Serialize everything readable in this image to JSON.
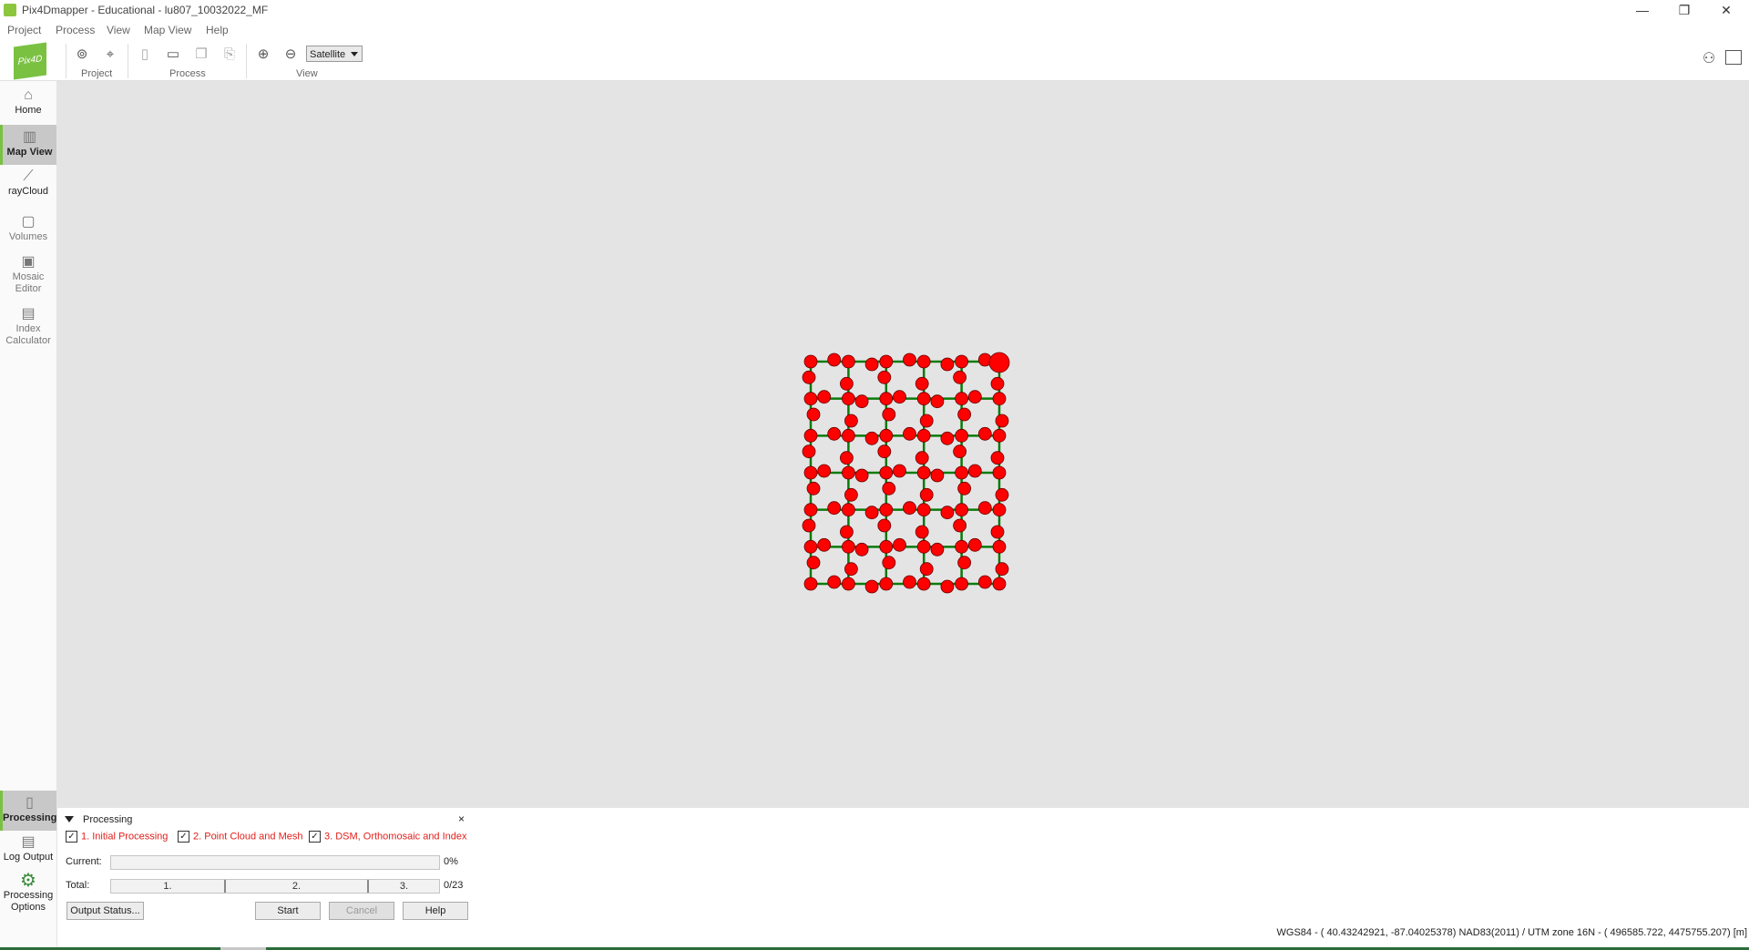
{
  "window": {
    "title": "Pix4Dmapper - Educational - lu807_10032022_MF",
    "minimize": "—",
    "maximize": "❐",
    "close": "✕"
  },
  "menu": [
    "Project",
    "Process",
    "View",
    "Map View",
    "Help"
  ],
  "toolbar": {
    "logo_text": "Pix4D",
    "groups": {
      "project": "Project",
      "process": "Process",
      "view": "View"
    },
    "basemap": "Satellite"
  },
  "sidebar": {
    "items": [
      {
        "label": "Home",
        "icon": "home-icon"
      },
      {
        "label": "Map View",
        "icon": "map-icon"
      },
      {
        "label": "rayCloud",
        "icon": "raycloud-icon"
      },
      {
        "label": "Volumes",
        "icon": "volumes-icon"
      },
      {
        "label": "Mosaic Editor",
        "icon": "mosaic-icon"
      },
      {
        "label": "Index Calculator",
        "icon": "calculator-icon"
      }
    ],
    "bottom": [
      {
        "label": "Processing",
        "icon": "processing-icon"
      },
      {
        "label": "Log Output",
        "icon": "log-icon"
      },
      {
        "label": "Processing Options",
        "icon": "gear-icon"
      }
    ]
  },
  "map": {
    "colors": {
      "point": "#ff0000",
      "path": "#0a7a0a"
    },
    "camera_grid_columns": 6,
    "camera_grid_rows": 7
  },
  "processing": {
    "title": "Processing",
    "close": "×",
    "steps": [
      {
        "label": "1. Initial Processing",
        "checked": true
      },
      {
        "label": "2. Point Cloud and Mesh",
        "checked": true
      },
      {
        "label": "3. DSM, Orthomosaic and Index",
        "checked": true
      }
    ],
    "current_label": "Current:",
    "current_value": "0%",
    "total_label": "Total:",
    "total_segments": [
      "1.",
      "2.",
      "3."
    ],
    "total_value": "0/23",
    "buttons": {
      "output_status": "Output Status...",
      "start": "Start",
      "cancel": "Cancel",
      "help": "Help"
    }
  },
  "status": {
    "text": "WGS84 - ( 40.43242921,  -87.04025378)  NAD83(2011) / UTM zone 16N - (   496585.722,   4475755.207) [m]"
  }
}
